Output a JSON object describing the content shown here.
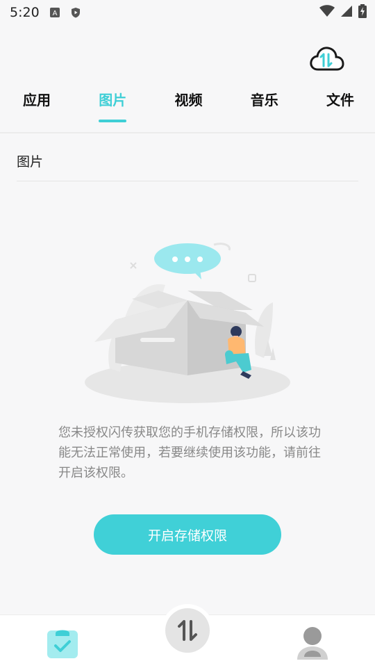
{
  "status_bar": {
    "time": "5:20",
    "icons": [
      "a-badge-icon",
      "shield-play-icon",
      "wifi-icon",
      "signal-icon",
      "battery-charging-icon"
    ]
  },
  "header": {
    "cloud_icon": "cloud-transfer-icon"
  },
  "tabs": [
    {
      "label": "应用",
      "active": false
    },
    {
      "label": "图片",
      "active": true
    },
    {
      "label": "视频",
      "active": false
    },
    {
      "label": "音乐",
      "active": false
    },
    {
      "label": "文件",
      "active": false
    }
  ],
  "section": {
    "title": "图片"
  },
  "empty_state": {
    "message": "您未授权闪传获取您的手机存储权限，所以该功能无法正常使用，若要继续使用该功能，请前往开启该权限。",
    "button_label": "开启存储权限"
  },
  "bottom_nav": {
    "left_icon": "clipboard-check-icon",
    "center_icon": "transfer-arrows-icon",
    "right_icon": "user-profile-icon"
  },
  "colors": {
    "accent": "#3fcfd6",
    "button": "#40d0d7",
    "muted_text": "#888888"
  }
}
